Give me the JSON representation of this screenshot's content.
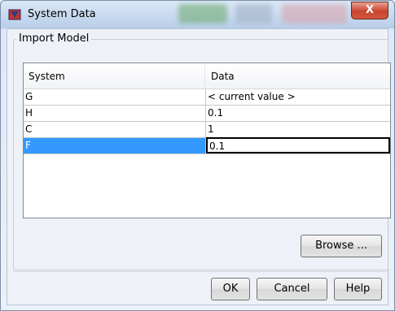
{
  "window": {
    "title": "System Data",
    "close_label": "X"
  },
  "group": {
    "title": "Import Model"
  },
  "table": {
    "headers": [
      "System",
      "Data"
    ],
    "rows": [
      {
        "system": "G",
        "data": "< current value >"
      },
      {
        "system": "H",
        "data": "0.1"
      },
      {
        "system": "C",
        "data": "1"
      },
      {
        "system": "F",
        "data": "0.1"
      }
    ],
    "selected_row": 3
  },
  "buttons": {
    "browse": "Browse ...",
    "ok": "OK",
    "cancel": "Cancel",
    "help": "Help"
  },
  "colors": {
    "selection": "#3399ff",
    "close": "#c8452e"
  }
}
